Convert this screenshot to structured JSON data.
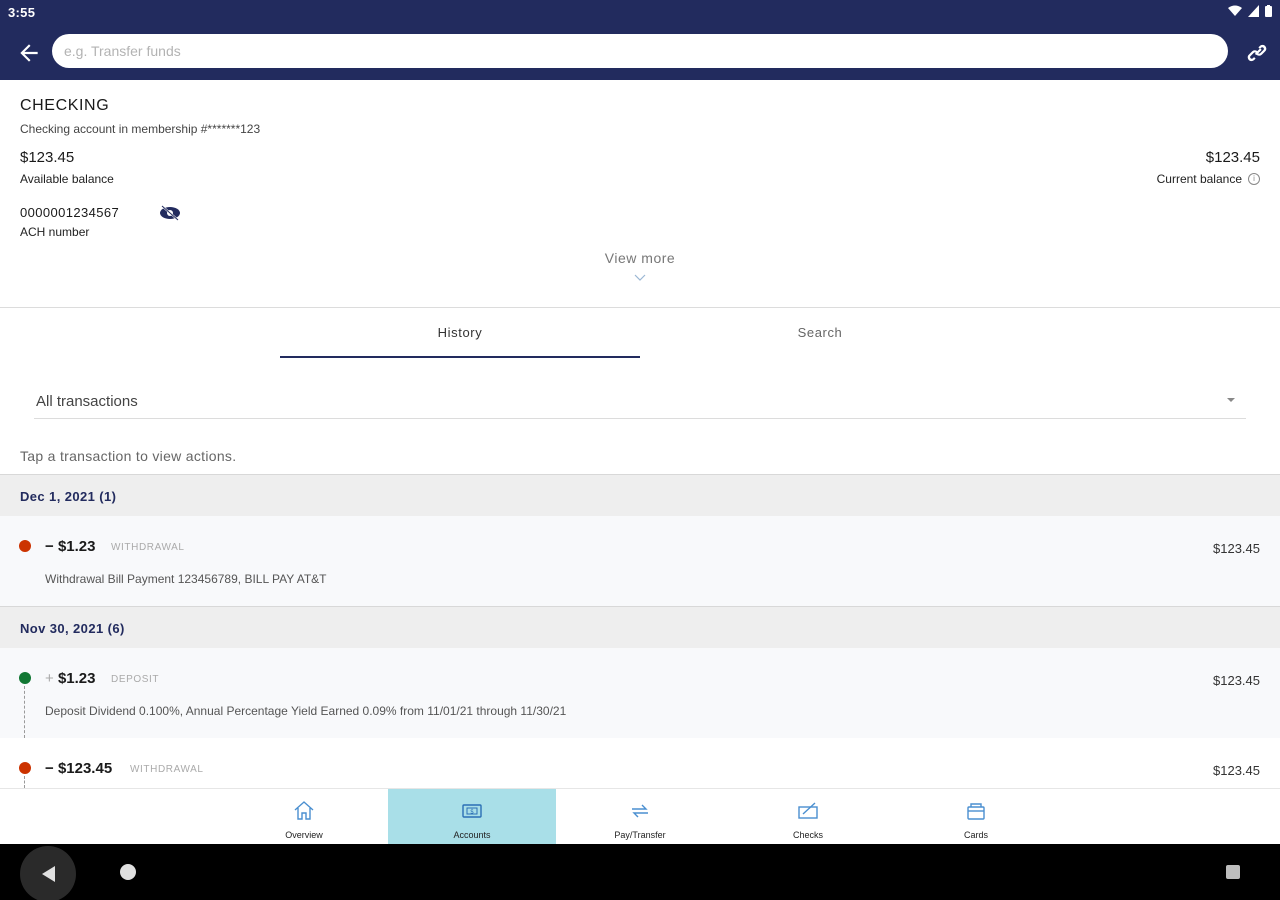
{
  "status": {
    "time": "3:55"
  },
  "search": {
    "placeholder": "e.g. Transfer funds"
  },
  "account": {
    "title": "CHECKING",
    "subtitle": "Checking account in membership #*******123",
    "available_balance": "$123.45",
    "available_label": "Available balance",
    "current_balance": "$123.45",
    "current_label": "Current balance",
    "ach_number": "0000001234567",
    "ach_label": "ACH number",
    "view_more": "View more"
  },
  "tabs": [
    {
      "label": "History",
      "active": true
    },
    {
      "label": "Search",
      "active": false
    }
  ],
  "filter": {
    "selected": "All transactions"
  },
  "hint": "Tap a transaction to view actions.",
  "groups": [
    {
      "date": "Dec 1, 2021 (1)"
    },
    {
      "date": "Nov 30, 2021 (6)"
    }
  ],
  "transactions": [
    {
      "sign": "−",
      "amount": "$1.23",
      "type": "WITHDRAWAL",
      "balance": "$123.45",
      "description": "Withdrawal Bill Payment 123456789, BILL PAY AT&T",
      "status": "withdrawal"
    },
    {
      "sign": "+",
      "amount": "$1.23",
      "type": "DEPOSIT",
      "balance": "$123.45",
      "description": "Deposit Dividend 0.100%, Annual Percentage Yield Earned 0.09% from 11/01/21 through 11/30/21",
      "status": "deposit"
    },
    {
      "sign": "−",
      "amount": "$123.45",
      "type": "WITHDRAWAL",
      "balance": "$123.45",
      "description": "",
      "status": "withdrawal"
    }
  ],
  "bottom_nav": [
    {
      "label": "Overview",
      "icon": "home-icon"
    },
    {
      "label": "Accounts",
      "icon": "accounts-icon",
      "active": true
    },
    {
      "label": "Pay/Transfer",
      "icon": "transfer-icon"
    },
    {
      "label": "Checks",
      "icon": "checks-icon"
    },
    {
      "label": "Cards",
      "icon": "cards-icon"
    }
  ],
  "colors": {
    "primary": "#222b5e",
    "active_nav": "#a9dfe8",
    "withdrawal": "#cc3300",
    "deposit": "#117733"
  }
}
